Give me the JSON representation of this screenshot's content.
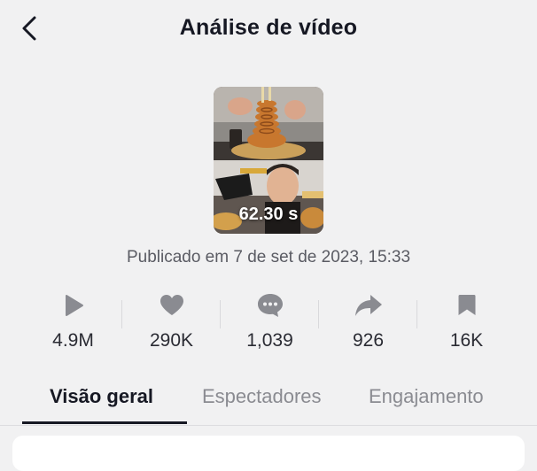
{
  "header": {
    "title": "Análise de vídeo",
    "back_icon": "chevron-left-icon"
  },
  "video": {
    "duration": "62.30 s",
    "published": "Publicado em 7 de set de 2023, 15:33"
  },
  "stats": [
    {
      "icon": "play-icon",
      "value": "4.9M"
    },
    {
      "icon": "heart-icon",
      "value": "290K"
    },
    {
      "icon": "comment-icon",
      "value": "1,039"
    },
    {
      "icon": "share-icon",
      "value": "926"
    },
    {
      "icon": "bookmark-icon",
      "value": "16K"
    }
  ],
  "tabs": [
    {
      "label": "Visão geral",
      "active": true
    },
    {
      "label": "Espectadores",
      "active": false
    },
    {
      "label": "Engajamento",
      "active": false
    }
  ],
  "colors": {
    "background": "#f1f1f2",
    "text": "#161823",
    "icon": "#8a8b91",
    "inactive_tab": "#8a8b91"
  }
}
